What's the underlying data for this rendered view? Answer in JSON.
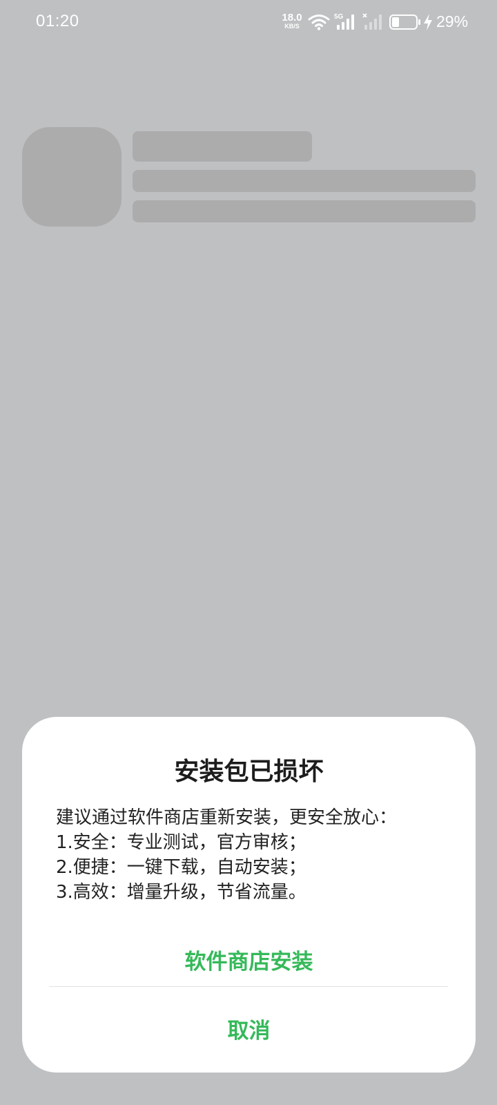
{
  "status_bar": {
    "time": "01:20",
    "net_speed_value": "18.0",
    "net_speed_unit": "KB/S",
    "network_type": "5G",
    "battery_percent": "29%",
    "battery_level": 0.29,
    "charging": true,
    "icons": [
      "wifi-icon",
      "signal-5g-icon",
      "signal-sim2-no-service-icon",
      "battery-icon",
      "charging-bolt-icon"
    ]
  },
  "dialog": {
    "title": "安装包已损坏",
    "body_lines": [
      "建议通过软件商店重新安装，更安全放心：",
      "1.安全：专业测试，官方审核；",
      "2.便捷：一键下载，自动安装；",
      "3.高效：增量升级，节省流量。"
    ],
    "primary_button": "软件商店安装",
    "cancel_button": "取消"
  },
  "colors": {
    "background": "#bfc0c2",
    "skeleton": "#acacad",
    "dialog_background": "#ffffff",
    "accent_green": "#35b959",
    "text": "#222222"
  }
}
